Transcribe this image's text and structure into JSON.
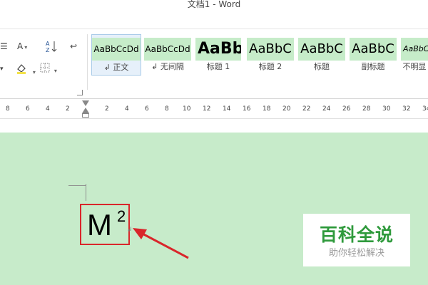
{
  "window": {
    "title": "文档1 - Word"
  },
  "styles_gallery": [
    {
      "preview": "AaBbCcDd",
      "label": "↲ 正文",
      "selected": true
    },
    {
      "preview": "AaBbCcDd",
      "label": "↲ 无间隔",
      "selected": false
    },
    {
      "preview": "AaBb",
      "label": "标题 1",
      "selected": false
    },
    {
      "preview": "AaBbC",
      "label": "标题 2",
      "selected": false
    },
    {
      "preview": "AaBbC",
      "label": "标题",
      "selected": false
    },
    {
      "preview": "AaBbC",
      "label": "副标题",
      "selected": false
    },
    {
      "preview": "AaBbC",
      "label": "不明显",
      "selected": false
    }
  ],
  "ruler": {
    "ticks": [
      "8",
      "6",
      "4",
      "2",
      "2",
      "4",
      "6",
      "8",
      "10",
      "12",
      "14",
      "16",
      "18",
      "20",
      "22",
      "24",
      "26",
      "28",
      "30",
      "32",
      "34"
    ]
  },
  "document": {
    "formula_base": "M",
    "formula_superscript": "2",
    "highlight_color": "#d9262b",
    "page_color": "#c7ebca"
  },
  "watermark": {
    "title": "百科全说",
    "subtitle": "助你轻松解决"
  },
  "toolbar": {
    "list_icon": "list-icon",
    "text_effects_icon": "text-effects-icon",
    "sort_icon": "sort-icon",
    "show_marks_icon": "show-formatting-icon",
    "shading_icon": "shading-icon",
    "borders_icon": "borders-icon"
  }
}
